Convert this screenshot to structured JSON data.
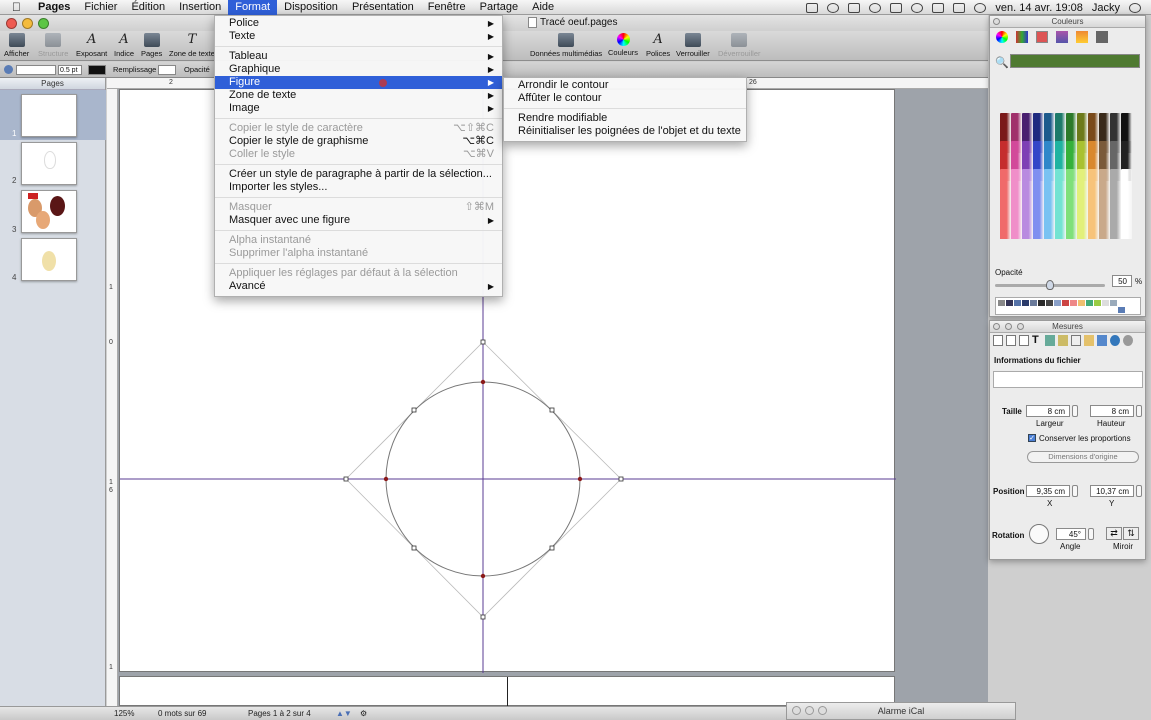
{
  "menubar": {
    "app_name": "Pages",
    "items": [
      "Fichier",
      "Édition",
      "Insertion",
      "Format",
      "Disposition",
      "Présentation",
      "Fenêtre",
      "Partage",
      "Aide"
    ],
    "active": "Format",
    "clock": "ven. 14 avr.  19:08",
    "user": "Jacky"
  },
  "window": {
    "title": "Tracé oeuf.pages"
  },
  "toolbar": {
    "items": [
      "Afficher",
      "Structure",
      "Exposant",
      "Indice",
      "Pages",
      "Zone de texte"
    ],
    "right_items": [
      "Données multimédias",
      "Couleurs",
      "Polices",
      "Verrouiller",
      "Déverrouiller"
    ]
  },
  "formatbar": {
    "stroke_value": "0.5 pt",
    "fill_label": "Remplissage :",
    "opacity_label": "Opacité"
  },
  "sidebar": {
    "header": "Pages",
    "pages": [
      "1",
      "2",
      "3",
      "4"
    ]
  },
  "ruler": {
    "h_ticks": [
      "2",
      "26"
    ],
    "v_ticks": [
      "1",
      "0",
      "1",
      "6",
      "1"
    ]
  },
  "format_menu": {
    "items": [
      {
        "label": "Police",
        "submenu": true
      },
      {
        "label": "Texte",
        "submenu": true
      },
      {
        "sep": true
      },
      {
        "label": "Tableau",
        "submenu": true
      },
      {
        "label": "Graphique",
        "submenu": true
      },
      {
        "label": "Figure",
        "submenu": true,
        "highlight": true
      },
      {
        "label": "Zone de texte",
        "submenu": true
      },
      {
        "label": "Image",
        "submenu": true
      },
      {
        "sep": true
      },
      {
        "label": "Copier le style de caractère",
        "shortcut": "⌥⇧⌘C",
        "disabled": true
      },
      {
        "label": "Copier le style de graphisme",
        "shortcut": "⌥⌘C"
      },
      {
        "label": "Coller le style",
        "shortcut": "⌥⌘V",
        "disabled": true
      },
      {
        "sep": true
      },
      {
        "label": "Créer un style de paragraphe à partir de la sélection..."
      },
      {
        "label": "Importer les styles..."
      },
      {
        "sep": true
      },
      {
        "label": "Masquer",
        "shortcut": "⇧⌘M",
        "disabled": true
      },
      {
        "label": "Masquer avec une figure",
        "submenu": true
      },
      {
        "sep": true
      },
      {
        "label": "Alpha instantané",
        "disabled": true
      },
      {
        "label": "Supprimer l'alpha instantané",
        "disabled": true
      },
      {
        "sep": true
      },
      {
        "label": "Appliquer les réglages par défaut à la sélection",
        "disabled": true
      },
      {
        "label": "Avancé",
        "submenu": true
      }
    ]
  },
  "figure_submenu": {
    "items": [
      {
        "label": "Arrondir le contour"
      },
      {
        "label": "Affûter le contour"
      },
      {
        "sep": true
      },
      {
        "label": "Rendre modifiable"
      },
      {
        "label": "Réinitialiser les poignées de l'objet et du texte"
      }
    ]
  },
  "colors_panel": {
    "title": "Couleurs",
    "opacity_label": "Opacité",
    "opacity_value": "50",
    "opacity_unit": "%",
    "opacity_fraction": 0.5
  },
  "measures_panel": {
    "title": "Mesures",
    "file_info_label": "Informations du fichier",
    "size_label": "Taille",
    "width_value": "8 cm",
    "height_value": "8 cm",
    "width_label": "Largeur",
    "height_label": "Hauteur",
    "keep_proportions": "Conserver les proportions",
    "original_size": "Dimensions d'origine",
    "position_label": "Position",
    "x_value": "9,35 cm",
    "y_value": "10,37 cm",
    "x_label": "X",
    "y_label": "Y",
    "rotation_label": "Rotation",
    "angle_value": "45°",
    "angle_label": "Angle",
    "mirror_label": "Miroir"
  },
  "bottombar": {
    "zoom": "125%",
    "word_count": "0 mots sur 69",
    "pages": "Pages 1 à 2 sur 4"
  },
  "ical": {
    "title": "Alarme iCal"
  }
}
